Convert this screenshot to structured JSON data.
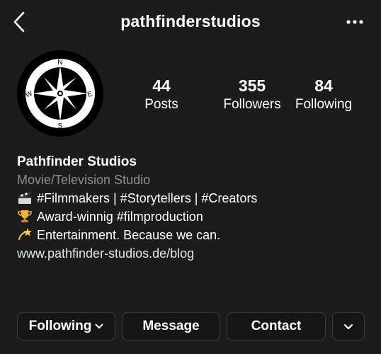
{
  "header": {
    "username": "pathfinderstudios",
    "back_icon": "chevron-left-icon",
    "more_icon": "more-horizontal-icon"
  },
  "avatar": {
    "description_icon": "compass-rose-icon",
    "letters": {
      "n": "N",
      "e": "E",
      "s": "S",
      "w": "W"
    }
  },
  "stats": [
    {
      "count": "44",
      "label": "Posts"
    },
    {
      "count": "355",
      "label": "Followers"
    },
    {
      "count": "84",
      "label": "Following"
    }
  ],
  "bio": {
    "name": "Pathfinder Studios",
    "category": "Movie/Television Studio",
    "lines": [
      {
        "icon": "clapper-board-icon",
        "text": "#Filmmakers | #Storytellers | #Creators"
      },
      {
        "icon": "trophy-icon",
        "text": "Award-winnig #filmproduction"
      },
      {
        "icon": "dizzy-star-icon",
        "text": "Entertainment. Because we can."
      }
    ],
    "link": "www.pathfinder-studios.de/blog"
  },
  "actions": {
    "following": "Following",
    "message": "Message",
    "contact": "Contact",
    "more_icon": "chevron-down-icon"
  },
  "colors": {
    "background": "#1c1c1c",
    "secondary_text": "#8e8e8e",
    "button_border": "#3b3b3b"
  }
}
